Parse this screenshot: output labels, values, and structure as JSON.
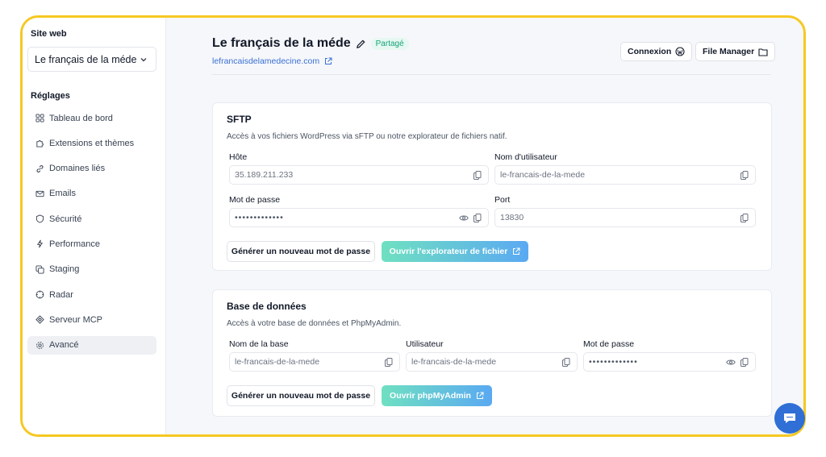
{
  "sidebar": {
    "site_heading": "Site web",
    "site_selected": "Le français de la méde",
    "settings_heading": "Réglages",
    "items": [
      {
        "label": "Tableau de bord",
        "icon": "dashboard-icon"
      },
      {
        "label": "Extensions et thèmes",
        "icon": "puzzle-icon"
      },
      {
        "label": "Domaines liés",
        "icon": "link-icon"
      },
      {
        "label": "Emails",
        "icon": "mail-icon"
      },
      {
        "label": "Sécurité",
        "icon": "shield-icon"
      },
      {
        "label": "Performance",
        "icon": "bolt-icon"
      },
      {
        "label": "Staging",
        "icon": "copy-icon"
      },
      {
        "label": "Radar",
        "icon": "radar-icon"
      },
      {
        "label": "Serveur MCP",
        "icon": "mcp-icon"
      },
      {
        "label": "Avancé",
        "icon": "gear-icon",
        "active": true
      }
    ]
  },
  "header": {
    "title": "Le français de la méde",
    "badge": "Partagé",
    "url": "lefrancaisdelamedecine.com",
    "login_button": "Connexion",
    "file_manager_button": "File Manager"
  },
  "sftp": {
    "title": "SFTP",
    "description": "Accès à vos fichiers WordPress via sFTP ou notre explorateur de fichiers natif.",
    "host_label": "Hôte",
    "host_value": "35.189.211.233",
    "username_label": "Nom d'utilisateur",
    "username_value": "le-francais-de-la-mede",
    "password_label": "Mot de passe",
    "password_value": "•••••••••••••",
    "port_label": "Port",
    "port_value": "13830",
    "new_password_button": "Générer un nouveau mot de passe",
    "explorer_button": "Ouvrir l'explorateur de fichier"
  },
  "database": {
    "title": "Base de données",
    "description": "Accès à votre base de données et PhpMyAdmin.",
    "dbname_label": "Nom de la base",
    "dbname_value": "le-francais-de-la-mede",
    "user_label": "Utilisateur",
    "user_value": "le-francais-de-la-mede",
    "password_label": "Mot de passe",
    "password_value": "•••••••••••••",
    "new_password_button": "Générer un nouveau mot de passe",
    "phpmyadmin_button": "Ouvrir phpMyAdmin"
  },
  "colors": {
    "frame_border": "#f6c822",
    "accent_blue": "#3b6fd4",
    "gradient_start": "#6fe0c1",
    "gradient_end": "#5aa9f2",
    "badge_green": "#16a37a"
  }
}
